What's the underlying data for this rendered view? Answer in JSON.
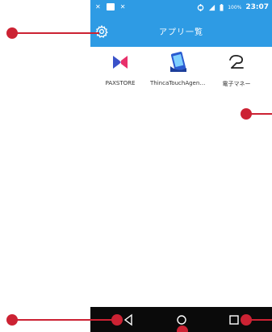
{
  "status_bar": {
    "left_glyph_1": "✕",
    "left_glyph_2": "✕",
    "signal_icon": "signal-icon",
    "battery_percent": "100%",
    "time": "23:07"
  },
  "app_bar": {
    "title": "アプリ一覧",
    "settings_icon": "gear-icon",
    "background_color": "#2e9be4"
  },
  "apps": [
    {
      "label": "PAXSTORE",
      "icon": "paxstore-icon"
    },
    {
      "label": "ThincaTouchAgent...",
      "icon": "thinca-touch-agent-icon"
    },
    {
      "label": "電子マネー",
      "icon": "electronic-money-icon"
    }
  ],
  "nav_bar": {
    "back_icon": "back-triangle-icon",
    "home_icon": "home-circle-icon",
    "recents_icon": "recents-square-icon"
  },
  "annotation_color": "#cc2233"
}
